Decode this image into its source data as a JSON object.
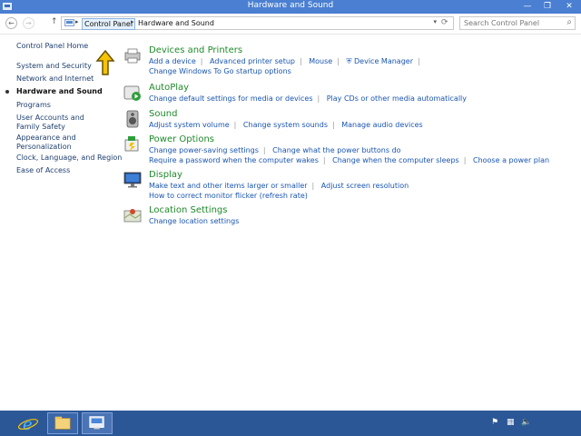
{
  "window": {
    "title": "Hardware and Sound"
  },
  "controls": {
    "minimize": "—",
    "restore": "❐",
    "close": "✕"
  },
  "nav": {
    "back": "←",
    "forward": "→",
    "up": "↑",
    "refresh": "⟳",
    "dropdown": "▾"
  },
  "address": {
    "crumbs": [
      "Control Panel",
      "Hardware and Sound"
    ],
    "separator": "▸"
  },
  "search": {
    "placeholder": "Search Control Panel"
  },
  "sidebar": {
    "items": [
      {
        "label": "Control Panel Home"
      },
      {
        "label": "System and Security"
      },
      {
        "label": "Network and Internet"
      },
      {
        "label": "Hardware and Sound",
        "active": true
      },
      {
        "label": "Programs"
      },
      {
        "label": "User Accounts and Family Safety"
      },
      {
        "label": "Appearance and Personalization"
      },
      {
        "label": "Clock, Language, and Region"
      },
      {
        "label": "Ease of Access"
      }
    ]
  },
  "categories": [
    {
      "heading": "Devices and Printers",
      "rows": [
        [
          "Add a device",
          "Advanced printer setup",
          "Mouse",
          "Device Manager"
        ],
        [
          "Change Windows To Go startup options"
        ]
      ]
    },
    {
      "heading": "AutoPlay",
      "rows": [
        [
          "Change default settings for media or devices",
          "Play CDs or other media automatically"
        ]
      ]
    },
    {
      "heading": "Sound",
      "rows": [
        [
          "Adjust system volume",
          "Change system sounds",
          "Manage audio devices"
        ]
      ]
    },
    {
      "heading": "Power Options",
      "rows": [
        [
          "Change power-saving settings",
          "Change what the power buttons do"
        ],
        [
          "Require a password when the computer wakes",
          "Change when the computer sleeps",
          "Choose a power plan"
        ]
      ]
    },
    {
      "heading": "Display",
      "rows": [
        [
          "Make text and other items larger or smaller",
          "Adjust screen resolution"
        ],
        [
          "How to correct monitor flicker (refresh rate)"
        ]
      ]
    },
    {
      "heading": "Location Settings",
      "rows": [
        [
          "Change location settings"
        ]
      ]
    }
  ],
  "colors": {
    "titlebar": "#4a7fd1",
    "taskbar": "#2b5797",
    "link": "#1a55b0",
    "heading": "#1f8a2a"
  }
}
